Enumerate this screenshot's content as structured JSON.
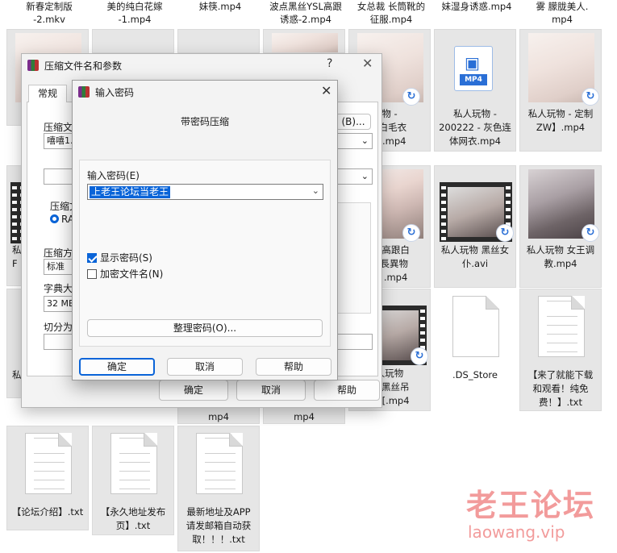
{
  "top_captions": [
    {
      "line1": "新春定制版",
      "line2": "-2.mkv"
    },
    {
      "line1": "美的纯白花嫁",
      "line2": "-1.mp4"
    },
    {
      "line1": "",
      "line2": "妹筷.mp4"
    },
    {
      "line1": "波点黑丝YSL高跟",
      "line2": "诱惑-2.mp4"
    },
    {
      "line1": "女总裁 长筒靴的",
      "line2": "征服.mp4"
    },
    {
      "line1": "",
      "line2": "妹湿身诱惑.mp4"
    },
    {
      "line1": "雾 朦胧美人.",
      "line2": "mp4"
    }
  ],
  "files": {
    "r1c5": {
      "l1": "物 -",
      "l2": "- 白毛衣",
      "l3": "毒.mp4"
    },
    "r1c6": {
      "icon_label": "MP4",
      "l1": "私人玩物 -",
      "l2": "200222 - 灰色连",
      "l3": "体网衣.mp4"
    },
    "r1c7": {
      "l1": "私人玩物 - 定制",
      "l2": "ZW】.mp4"
    },
    "r2c1": {
      "l1": "私",
      "l2": "F"
    },
    "r2c5": {
      "l1": "物 高跟白",
      "l2": "细長異物",
      "l3": "穴 .mp4"
    },
    "r2c6": {
      "l1": "私人玩物 黑丝女",
      "l2": "仆.avi"
    },
    "r2c7": {
      "l1": "私人玩物 女王调",
      "l2": "教.mp4"
    },
    "r3c1": {
      "l1": "私"
    },
    "r3c5": {
      "l1": "人玩物",
      "l2": "23黑丝吊",
      "l3": "版 [.mp4"
    },
    "r3c6": {
      "l1": ".DS_Store"
    },
    "r3c7": {
      "l1": "【来了就能下载",
      "l2": "和观看！纯免",
      "l3": "费！】.txt"
    },
    "r3c3": {
      "l1": "mp4"
    },
    "r3c4": {
      "l1": "mp4"
    },
    "r4c1": {
      "l1": "【论坛介绍】.txt"
    },
    "r4c2": {
      "l1": "【永久地址发布",
      "l2": "页】.txt"
    },
    "r4c3": {
      "l1": "最新地址及APP",
      "l2": "请发邮箱自动获",
      "l3": "取！！！.txt"
    }
  },
  "outer_dialog": {
    "title": "压缩文件名和参数",
    "help": "?",
    "close": "✕",
    "tab_general": "常规",
    "label_archive": "压缩文",
    "archive_value": "嘻嘻1.",
    "browse_button": "(B)...",
    "label_format": "压缩文",
    "format_radio": "RA",
    "label_method": "压缩方",
    "method_value": "标准",
    "label_dict": "字典大",
    "dict_value": "32 MB",
    "label_split": "切分为",
    "ok": "确定",
    "cancel": "取消",
    "help_button": "帮助"
  },
  "password_dialog": {
    "title": "输入密码",
    "close": "✕",
    "heading": "带密码压缩",
    "enter_label": "输入密码(E)",
    "password_value": "上老王论坛当老王",
    "show_password": "显示密码(S)",
    "show_password_checked": true,
    "encrypt_names": "加密文件名(N)",
    "encrypt_names_checked": false,
    "organize_button": "整理密码(O)...",
    "ok": "确定",
    "cancel": "取消",
    "help": "帮助"
  },
  "watermark": {
    "cn": "老王论坛",
    "en": "laowang.vip"
  },
  "colors": {
    "accent": "#0a64d8",
    "watermark": "#f08a8a"
  }
}
